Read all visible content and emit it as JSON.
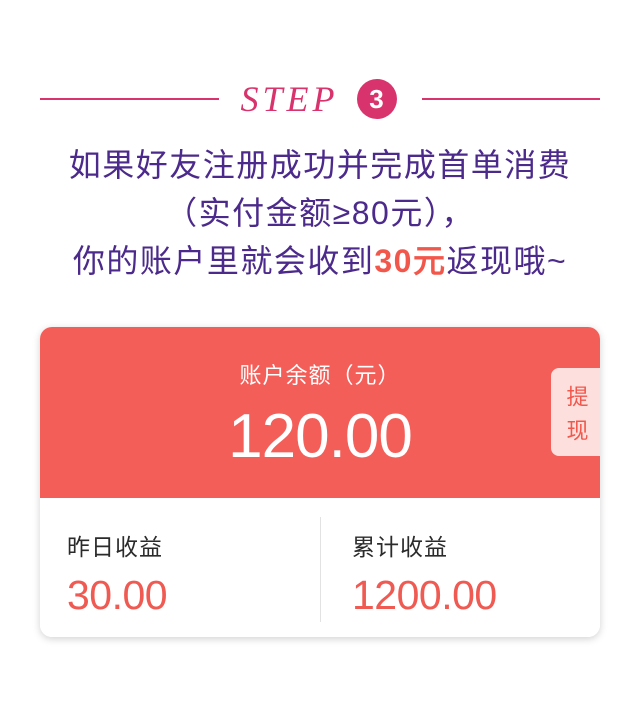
{
  "colors": {
    "accent_pink": "#d8336c",
    "text_purple": "#4c2a8b",
    "highlight_coral": "#f2574c",
    "card_coral": "#f45e59",
    "withdraw_bg": "#fde0de",
    "value_coral": "#ef5a52",
    "label_dark": "#2b2b2b",
    "divider": "#e2e2e2"
  },
  "step": {
    "label": "STEP",
    "number": "3"
  },
  "description": {
    "line1": "如果好友注册成功并完成首单消费",
    "line2": "（实付金额≥80元），",
    "line3": {
      "before": "你的账户里就会收到",
      "highlight": "30元",
      "after": "返现哦~"
    }
  },
  "balance_card": {
    "title": "账户余额（元）",
    "amount": "120.00",
    "withdraw_label": "提现",
    "stats": [
      {
        "label": "昨日收益",
        "value": "30.00"
      },
      {
        "label": "累计收益",
        "value": "1200.00"
      }
    ]
  }
}
